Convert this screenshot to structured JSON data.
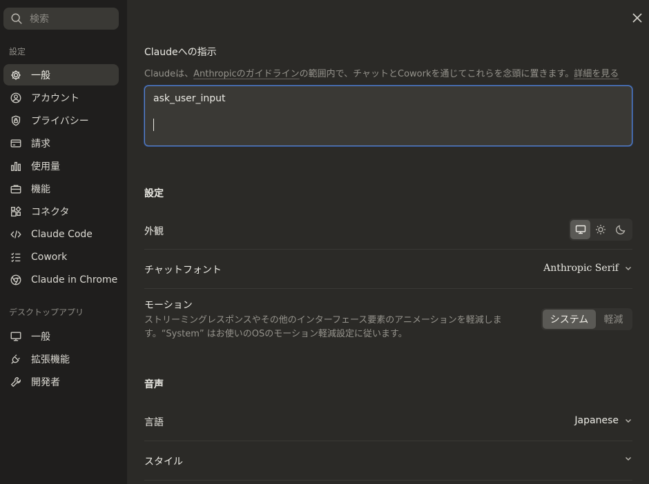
{
  "search": {
    "placeholder": "検索"
  },
  "sidebar": {
    "settings_label": "設定",
    "settings_items": [
      {
        "label": "一般",
        "icon": "gear-icon",
        "active": true
      },
      {
        "label": "アカウント",
        "icon": "user-circle-icon"
      },
      {
        "label": "プライバシー",
        "icon": "shield-lock-icon"
      },
      {
        "label": "請求",
        "icon": "credit-card-icon"
      },
      {
        "label": "使用量",
        "icon": "bar-chart-icon"
      },
      {
        "label": "機能",
        "icon": "briefcase-icon"
      },
      {
        "label": "コネクタ",
        "icon": "connector-icon"
      },
      {
        "label": "Claude Code",
        "icon": "code-icon"
      },
      {
        "label": "Cowork",
        "icon": "checklist-icon"
      },
      {
        "label": "Claude in Chrome",
        "icon": "globe-icon"
      }
    ],
    "desktop_label": "デスクトップアプリ",
    "desktop_items": [
      {
        "label": "一般",
        "icon": "monitor-icon"
      },
      {
        "label": "拡張機能",
        "icon": "plug-icon"
      },
      {
        "label": "開発者",
        "icon": "wrench-icon"
      }
    ]
  },
  "instructions": {
    "title": "Claudeへの指示",
    "desc_prefix": "Claudeは、",
    "desc_link1": "Anthropicのガイドライン",
    "desc_middle": "の範囲内で、チャットとCoworkを通じてこれらを念頭に置きます。",
    "desc_link2": "詳細を見る",
    "value": "ask_user_input"
  },
  "settings": {
    "title": "設定",
    "appearance_label": "外観",
    "appearance_selected": "system",
    "chat_font_label": "チャットフォント",
    "chat_font_value": "Anthropic Serif",
    "motion_label": "モーション",
    "motion_desc": "ストリーミングレスポンスやその他のインターフェース要素のアニメーションを軽減します。“System” はお使いのOSのモーション軽減設定に従います。",
    "motion_options": [
      "システム",
      "軽減"
    ]
  },
  "voice": {
    "title": "音声",
    "language_label": "言語",
    "language_value": "Japanese",
    "style_label": "スタイル"
  },
  "colors": {
    "accent_focus": "#5b82c9",
    "sidebar_bg": "#1f1e1d",
    "main_bg": "#2b2a27"
  }
}
